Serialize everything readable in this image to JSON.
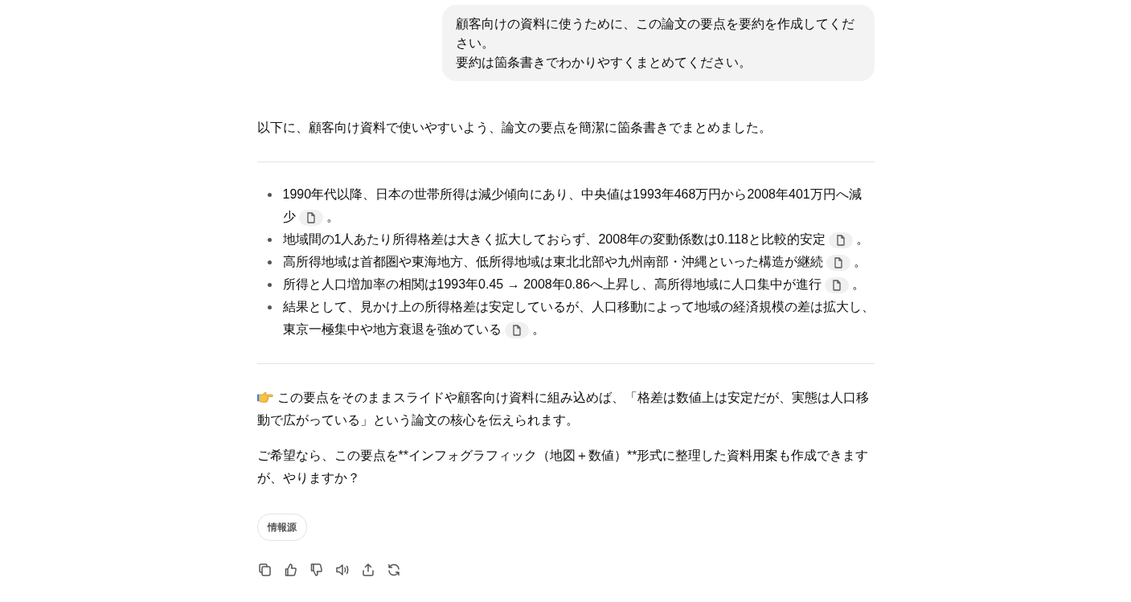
{
  "user_message": {
    "lines": [
      "顧客向けの資料に使うために、この論文の要点を要約を作成してください。",
      "要約は箇条書きでわかりやすくまとめてください。"
    ]
  },
  "reply": {
    "intro": "以下に、顧客向け資料で使いやすいよう、論文の要点を簡潔に箇条書きでまとめました。",
    "bullets": [
      {
        "lines": [
          "1990年代以降、日本の世帯所得は減少傾向にあり、中央値は1993年468万円から2008年401万円へ減",
          "少"
        ],
        "end": "。"
      },
      {
        "lines": [
          "地域間の1人あたり所得格差は大きく拡大しておらず、2008年の変動係数は0.118と比較的安定"
        ],
        "end": "。"
      },
      {
        "lines": [
          "高所得地域は首都圏や東海地方、低所得地域は東北北部や九州南部・沖縄といった構造が継続"
        ],
        "end": "。"
      },
      {
        "lines": [
          "所得と人口増加率の相関は1993年0.45 → 2008年0.86へ上昇し、高所得地域に人口集中が進行"
        ],
        "end": "。"
      },
      {
        "lines": [
          "結果として、見かけ上の所得格差は安定しているが、人口移動によって地域の経済規模の差は拡大し、",
          "東京一極集中や地方衰退を強めている"
        ],
        "end": "。"
      }
    ],
    "paragraphs": [
      {
        "kind": "pointer",
        "text": "この要点をそのままスライドや顧客向け資料に組み込めば、「格差は数値上は安定だが、実態は人口移動で広がっている」という論文の核心を伝えられます。"
      },
      {
        "kind": "plain",
        "text": "ご希望なら、この要点を**インフォグラフィック（地図＋数値）**形式に整理した資料用案も作成できますが、やりますか？"
      }
    ],
    "sources_button": "情報源"
  }
}
